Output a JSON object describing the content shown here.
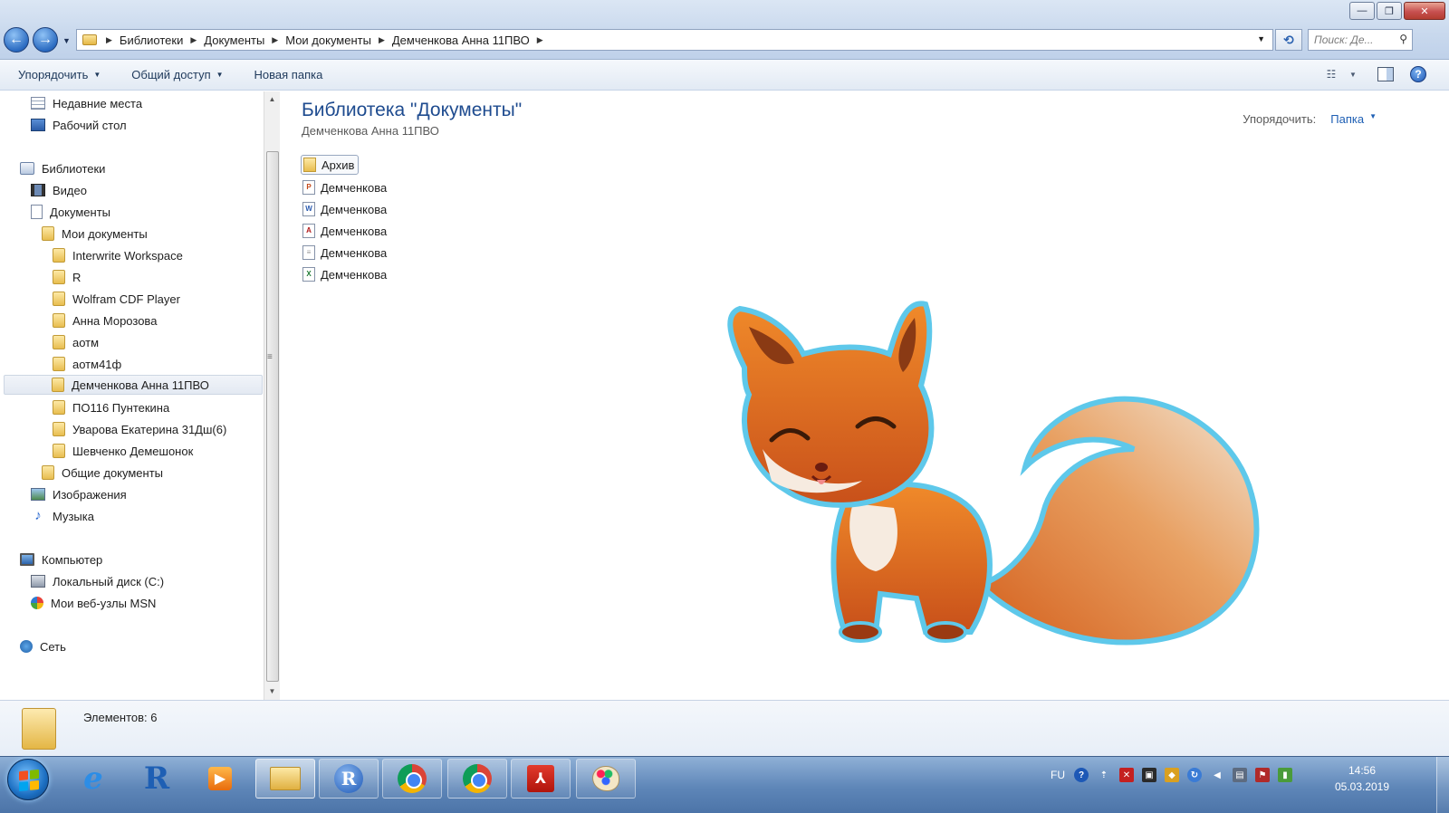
{
  "address_bar": {
    "crumbs": [
      "Библиотеки",
      "Документы",
      "Мои документы",
      "Демченкова Анна 11ПВО"
    ],
    "search_placeholder": "Поиск: Де..."
  },
  "toolbar": {
    "organize": "Упорядочить",
    "share": "Общий доступ",
    "new_folder": "Новая папка"
  },
  "nav": {
    "recent": "Недавние места",
    "desktop": "Рабочий стол",
    "libraries": "Библиотеки",
    "video": "Видео",
    "documents": "Документы",
    "my_documents": "Мои документы",
    "folders": [
      "Interwrite Workspace",
      "R",
      "Wolfram CDF Player",
      "Анна Морозова",
      "аотм",
      "аотм41ф",
      "Демченкова Анна 11ПВО",
      "ПО116 Пунтекина",
      "Уварова Екатерина 31Дш(6)",
      "Шевченко Демешонок"
    ],
    "public_documents": "Общие документы",
    "images": "Изображения",
    "music": "Музыка",
    "computer": "Компьютер",
    "local_disk": "Локальный диск (C:)",
    "msn": "Мои веб-узлы MSN",
    "network": "Сеть"
  },
  "content": {
    "title": "Библиотека \"Документы\"",
    "subtitle": "Демченкова Анна 11ПВО",
    "arrange_label": "Упорядочить:",
    "arrange_value": "Папка",
    "files": [
      {
        "name": "Архив",
        "icon": "folder-icon"
      },
      {
        "name": "Демченкова",
        "icon": "powerpoint-file-icon"
      },
      {
        "name": "Демченкова",
        "icon": "word-file-icon"
      },
      {
        "name": "Демченкова",
        "icon": "pdf-file-icon"
      },
      {
        "name": "Демченкова",
        "icon": "text-file-icon"
      },
      {
        "name": "Демченкова",
        "icon": "excel-file-icon"
      }
    ]
  },
  "details": {
    "count_text": "Элементов: 6"
  },
  "taskbar": {
    "apps": [
      "internet-explorer-icon",
      "r-gui-icon",
      "media-player-icon",
      "windows-explorer-icon",
      "r-studio-icon",
      "chrome-icon",
      "chrome-icon",
      "acrobat-icon",
      "paint-icon"
    ],
    "language": "FU",
    "time": "14:56",
    "date": "05.03.2019"
  },
  "colors": {
    "title_blue": "#1e4b8f",
    "link_blue": "#1e5fb4",
    "taskbar": "#5e86b8"
  }
}
